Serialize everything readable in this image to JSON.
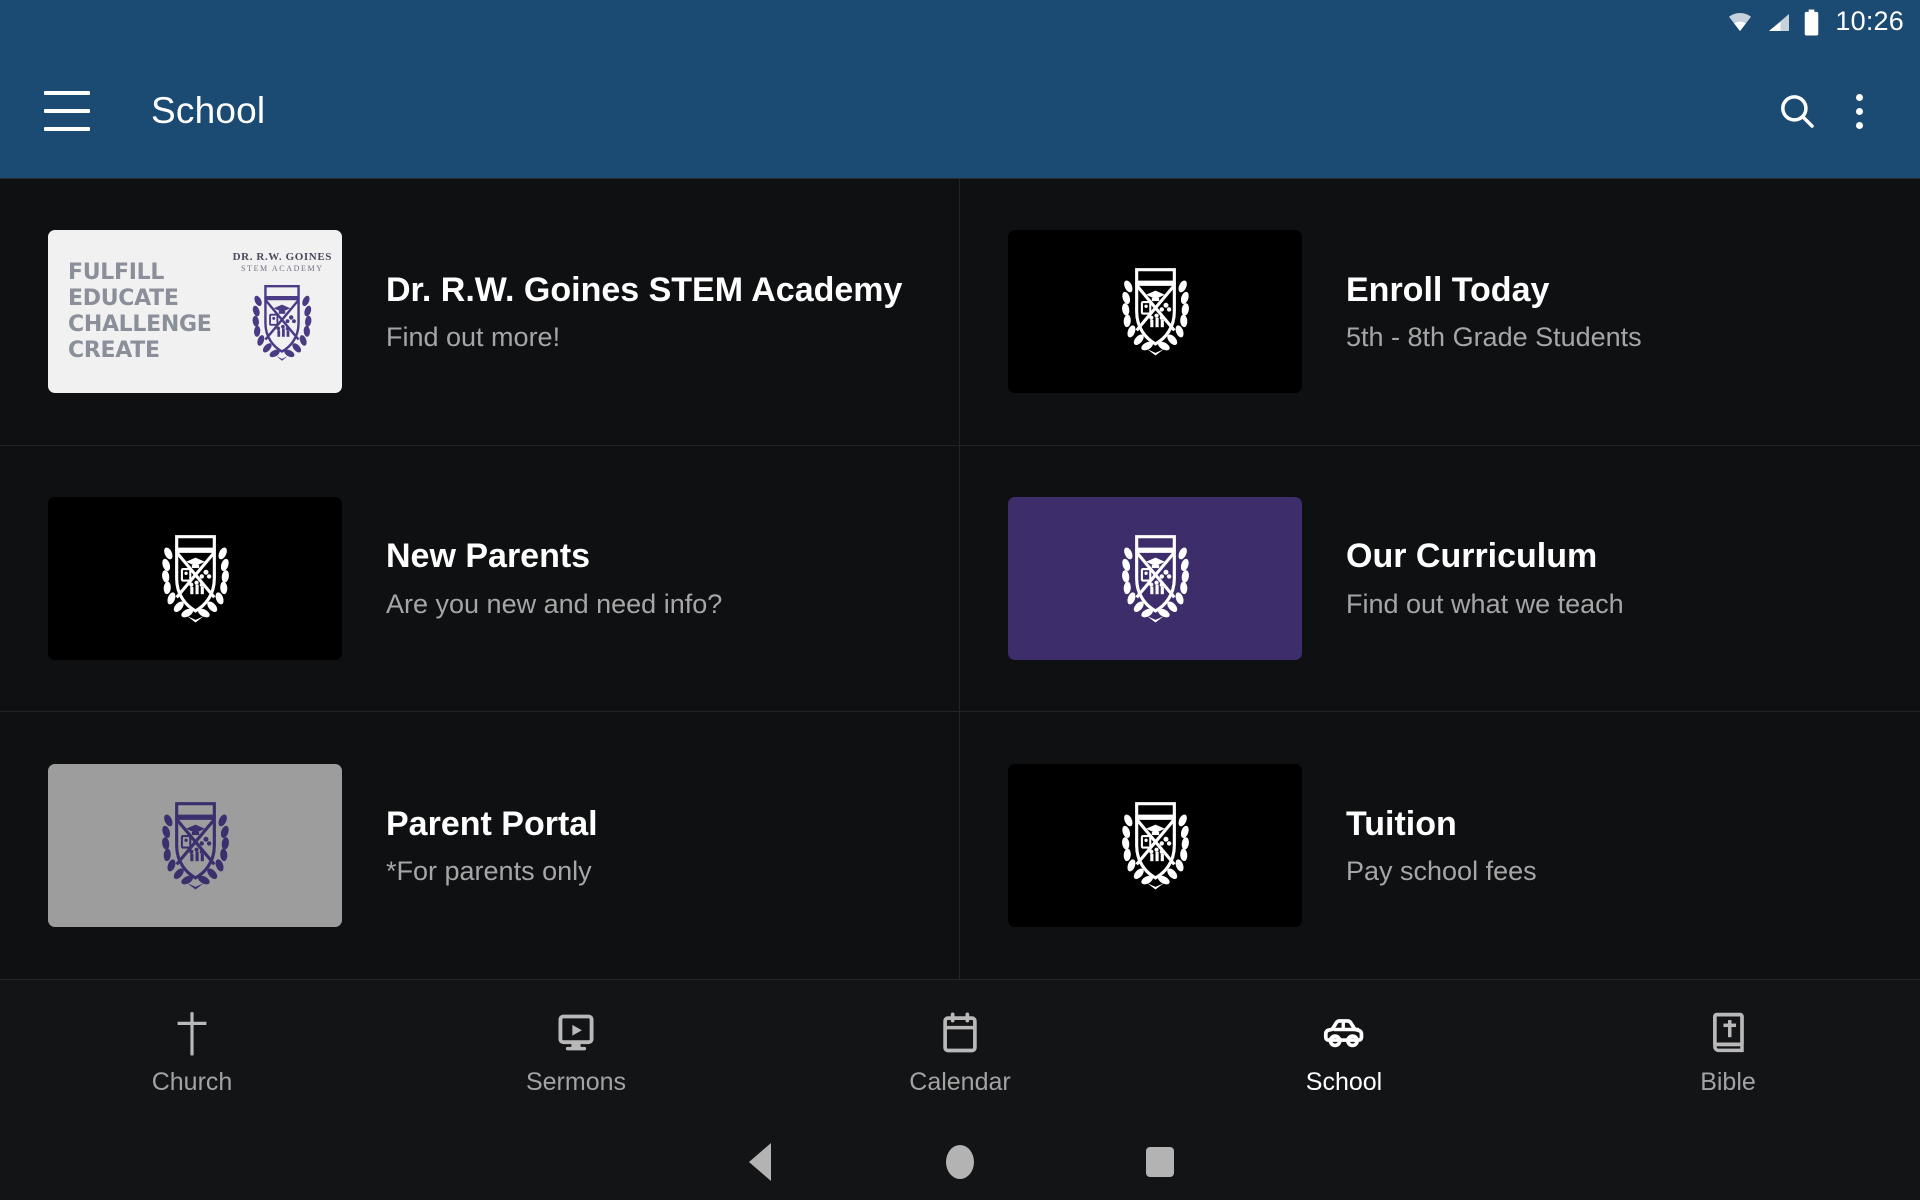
{
  "status_bar": {
    "time": "10:26",
    "icons": [
      "wifi-icon",
      "cellular-signal-icon",
      "battery-icon"
    ]
  },
  "app_bar": {
    "menu_icon": "hamburger-menu-icon",
    "title": "School",
    "search_icon": "search-icon",
    "overflow_icon": "more-vertical-icon"
  },
  "promo_thumb": {
    "words": [
      "FULFILL",
      "EDUCATE",
      "CHALLENGE",
      "CREATE"
    ],
    "logo_line1": "DR. R.W. GOINES",
    "logo_line2": "STEM ACADEMY"
  },
  "grid": {
    "items": [
      {
        "title": "Dr. R.W. Goines STEM Academy",
        "subtitle": "Find out more!",
        "thumb_style": "promo",
        "thumb_icon": "school-crest-logo"
      },
      {
        "title": "Enroll Today",
        "subtitle": "5th - 8th Grade Students",
        "thumb_style": "black",
        "thumb_icon": "school-crest-logo"
      },
      {
        "title": "New Parents",
        "subtitle": "Are you new and need info?",
        "thumb_style": "black",
        "thumb_icon": "school-crest-logo"
      },
      {
        "title": "Our Curriculum",
        "subtitle": "Find out what we teach",
        "thumb_style": "purple",
        "thumb_icon": "school-crest-logo"
      },
      {
        "title": "Parent Portal",
        "subtitle": "*For parents only",
        "thumb_style": "gray",
        "thumb_icon": "school-crest-logo"
      },
      {
        "title": "Tuition",
        "subtitle": "Pay school fees",
        "thumb_style": "black",
        "thumb_icon": "school-crest-logo"
      }
    ]
  },
  "tab_bar": {
    "active": "School",
    "tabs": [
      {
        "label": "Church",
        "icon": "cross-icon",
        "active": false
      },
      {
        "label": "Sermons",
        "icon": "video-play-icon",
        "active": false
      },
      {
        "label": "Calendar",
        "icon": "calendar-icon",
        "active": false
      },
      {
        "label": "School",
        "icon": "car-icon",
        "active": true
      },
      {
        "label": "Bible",
        "icon": "bible-book-icon",
        "active": false
      }
    ]
  },
  "android_nav": {
    "back": "back-triangle-icon",
    "home": "home-circle-icon",
    "recents": "recents-square-icon"
  },
  "colors": {
    "app_bar": "#1b4a72",
    "background": "#0f1012",
    "tile_purple": "#3e2d6b",
    "tile_gray": "#9d9d9d",
    "tile_black": "#000000",
    "title_text": "#ffffff",
    "subtitle_text": "#a6a6a6"
  }
}
